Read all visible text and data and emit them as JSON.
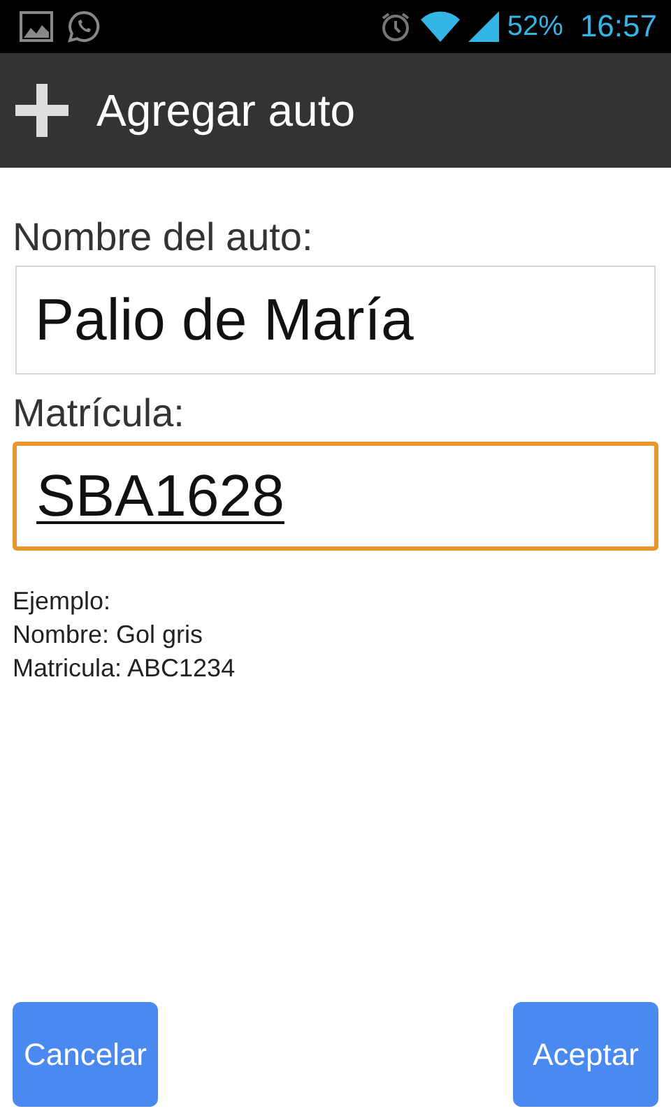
{
  "status_bar": {
    "battery": "52%",
    "time": "16:57"
  },
  "action_bar": {
    "title": "Agregar auto"
  },
  "fields": [
    {
      "label": "Nombre del auto:",
      "value": "Palio de María",
      "focused": false
    },
    {
      "label": "Matrícula:",
      "value": "SBA1628",
      "focused": true
    }
  ],
  "hint": [
    "Ejemplo:",
    "Nombre: Gol gris",
    "Matricula: ABC1234"
  ],
  "buttons": [
    "Cancelar",
    "Aceptar"
  ]
}
